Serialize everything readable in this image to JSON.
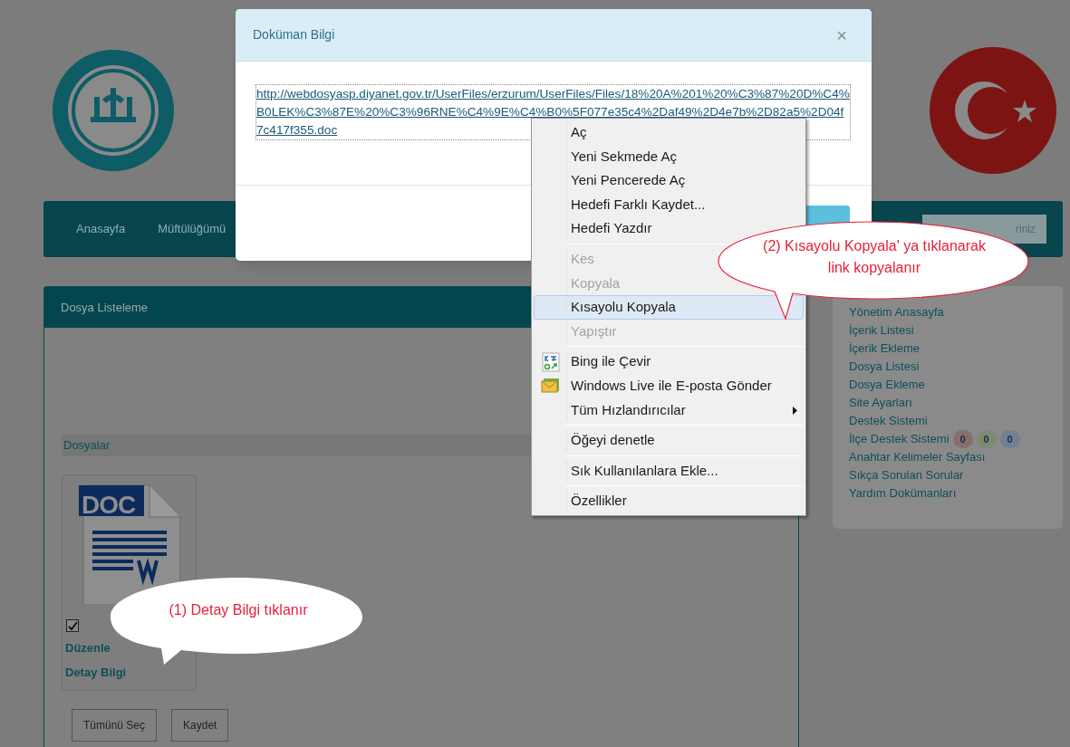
{
  "nav": {
    "items": [
      "Anasayfa",
      "Müftülüğümü"
    ],
    "search": {
      "placeholder": "riniz"
    }
  },
  "file_panel": {
    "title": "Dosya Listeleme",
    "section": "Dosyalar",
    "files": [
      {
        "type": "DOC",
        "checked": true,
        "links": [
          "Düzenle",
          "Detay Bilgi"
        ]
      }
    ],
    "buttons": [
      "Tümünü Seç",
      "Kaydet"
    ]
  },
  "sidebar": {
    "items": [
      {
        "label": "Yönetim Anasayfa"
      },
      {
        "label": "İçerik Listesi"
      },
      {
        "label": "İçerik Ekleme"
      },
      {
        "label": "Dosya Listesi"
      },
      {
        "label": "Dosya Ekleme"
      },
      {
        "label": "Site Ayarları"
      },
      {
        "label": "Destek Sistemi"
      },
      {
        "label": "İlçe Destek Sistemi",
        "badges": [
          {
            "text": "0",
            "color": "#8a6d6d"
          },
          {
            "text": "0",
            "color": "#7d8a6e"
          },
          {
            "text": "0",
            "color": "#6f8193"
          }
        ]
      },
      {
        "label": "Anahtar Kelimeler Sayfası"
      },
      {
        "label": "Sıkça Sorulan Sorular"
      },
      {
        "label": "Yardım Dokümanları"
      }
    ]
  },
  "modal": {
    "title": "Doküman Bilgi",
    "close": "×",
    "link": "http://webdosyasp.diyanet.gov.tr/UserFiles/erzurum/UserFiles/Files/18%20A%201%20%C3%87%20D%C4%B0LEK%C3%87E%20%C3%96RNE%C4%9E%C4%B0%5F077e35c4%2Daf49%2D4e7b%2D82a5%2D04f7c417f355.doc"
  },
  "context_menu": [
    {
      "kind": "plain",
      "label": "Aç",
      "disabled": false,
      "selected": false
    },
    {
      "kind": "plain",
      "label": "Yeni Sekmede Aç",
      "disabled": false,
      "selected": false
    },
    {
      "kind": "plain",
      "label": "Yeni Pencerede Aç",
      "disabled": false,
      "selected": false
    },
    {
      "kind": "plain",
      "label": "Hedefi Farklı Kaydet...",
      "disabled": false,
      "selected": false
    },
    {
      "kind": "plain",
      "label": "Hedefi Yazdır",
      "disabled": false,
      "selected": false
    },
    {
      "kind": "separator"
    },
    {
      "kind": "plain",
      "label": "Kes",
      "disabled": true,
      "selected": false
    },
    {
      "kind": "plain",
      "label": "Kopyala",
      "disabled": true,
      "selected": false
    },
    {
      "kind": "plain",
      "label": "Kısayolu Kopyala",
      "disabled": false,
      "selected": true
    },
    {
      "kind": "plain",
      "label": "Yapıştır",
      "disabled": true,
      "selected": false
    },
    {
      "kind": "separator"
    },
    {
      "kind": "translate",
      "label": "Bing ile Çevir",
      "disabled": false,
      "selected": false
    },
    {
      "kind": "mail",
      "label": "Windows Live ile E-posta Gönder",
      "disabled": false,
      "selected": false
    },
    {
      "kind": "submenu",
      "label": "Tüm Hızlandırıcılar",
      "disabled": false,
      "selected": false
    },
    {
      "kind": "separator"
    },
    {
      "kind": "plain",
      "label": "Öğeyi denetle",
      "disabled": false,
      "selected": false
    },
    {
      "kind": "separator"
    },
    {
      "kind": "plain",
      "label": "Sık Kullanılanlara Ekle...",
      "disabled": false,
      "selected": false
    },
    {
      "kind": "separator"
    },
    {
      "kind": "plain",
      "label": "Özellikler",
      "disabled": false,
      "selected": false
    }
  ],
  "callouts": [
    {
      "text": "(1) Detay Bilgi tıklanır"
    },
    {
      "text": "(2) Kısayolu Kopyala' ya tıklanarak link kopyalanır"
    }
  ]
}
